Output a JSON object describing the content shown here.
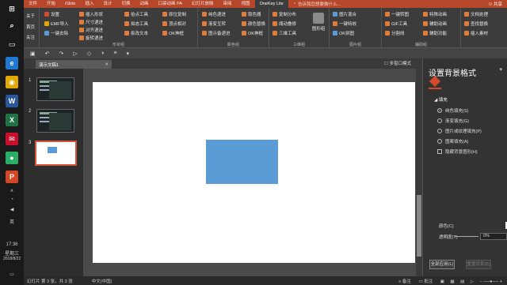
{
  "taskbar": {
    "time": "17:36",
    "weekday": "星期三",
    "date": "2018/8/22",
    "ime": "英",
    "app_icons": [
      {
        "name": "search-icon",
        "glyph": "⌕",
        "color": "#1a1a1a"
      },
      {
        "name": "taskview-icon",
        "glyph": "▭",
        "color": "#1a1a1a"
      },
      {
        "name": "edge-icon",
        "glyph": "e",
        "color": "#1e78d4"
      },
      {
        "name": "chrome-icon",
        "glyph": "◉",
        "color": "#e0a800"
      },
      {
        "name": "word-icon",
        "glyph": "W",
        "color": "#2b579a"
      },
      {
        "name": "excel-icon",
        "glyph": "X",
        "color": "#217346"
      },
      {
        "name": "app-icon",
        "glyph": "✉",
        "color": "#c8102e"
      },
      {
        "name": "wechat-icon",
        "glyph": "●",
        "color": "#2aae67"
      },
      {
        "name": "powerpoint-icon",
        "glyph": "P",
        "color": "#d24726"
      }
    ]
  },
  "menu_tabs": [
    "文件",
    "开始",
    "iSlide",
    "插入",
    "设计",
    "切换",
    "动画",
    "口袋动画 PA",
    "幻灯片放映",
    "审阅",
    "视图",
    "OneKey Lite"
  ],
  "active_tab": "OneKey Lite",
  "search_text": "告诉我您想要做什么...",
  "share_label": "共享",
  "ribbon": {
    "col_about": [
      "关于",
      "首页",
      "关注"
    ],
    "col_settings": [
      "设置",
      "EMF导入",
      "一键去除"
    ],
    "col_a": [
      "插入形状",
      "尺寸递进",
      "对齐递进",
      "旋转递进"
    ],
    "col_b": [
      "拾点工具",
      "拟态工具",
      "拆改文本"
    ],
    "col_c": [
      "原位复制",
      "顶点相对",
      "OK神框"
    ],
    "group_shape": "形状组",
    "col_d": [
      "纯色递进",
      "渐变互转",
      "图示备递进"
    ],
    "col_e": [
      "取色器",
      "颜色替换",
      "OK神框"
    ],
    "group_color": "颜色组",
    "col_f": [
      "复制分布",
      "阈动叠修",
      "三维工具"
    ],
    "group_3d": "三维组",
    "big_3d": "图形组",
    "col_g": [
      "图片混合",
      "一键特效",
      "OK拼图"
    ],
    "group_image": "图片组",
    "col_h": [
      "一键转图",
      "GIF工具",
      "分割线"
    ],
    "col_i": [
      "特殊动画",
      "辅助动画",
      "辅助功能"
    ],
    "group_aux": "辅助组",
    "col_j": [
      "文档处理",
      "查找替换",
      "插入素材"
    ]
  },
  "doc_tab": "演示文稿1",
  "multi_window": "多窗口模式",
  "slide_numbers": [
    "1",
    "2",
    "3"
  ],
  "pane": {
    "title": "设置背景格式",
    "section": "填充",
    "options": [
      "纯色填充(S)",
      "渐变填充(G)",
      "图片或纹理填充(P)",
      "图案填充(A)"
    ],
    "selected_option": "纯色填充(S)",
    "hide_bg": "隐藏背景图形(H)",
    "color_label": "颜色(C)",
    "transparency_label": "透明度(T)",
    "transparency_value": "0%",
    "apply_all": "全部应用(L)",
    "reset": "重置背景(B)"
  },
  "status": {
    "slide_info": "幻灯片 第 3 张，共 3 张",
    "language": "中文(中国)",
    "notes": "备注",
    "comments": "批注"
  },
  "colors": {
    "tabs_bg": "#b7472a",
    "shape_fill": "#5b9bd5",
    "slide_bg": "#ffffff",
    "selected_thumb_border": "#d3553a"
  }
}
